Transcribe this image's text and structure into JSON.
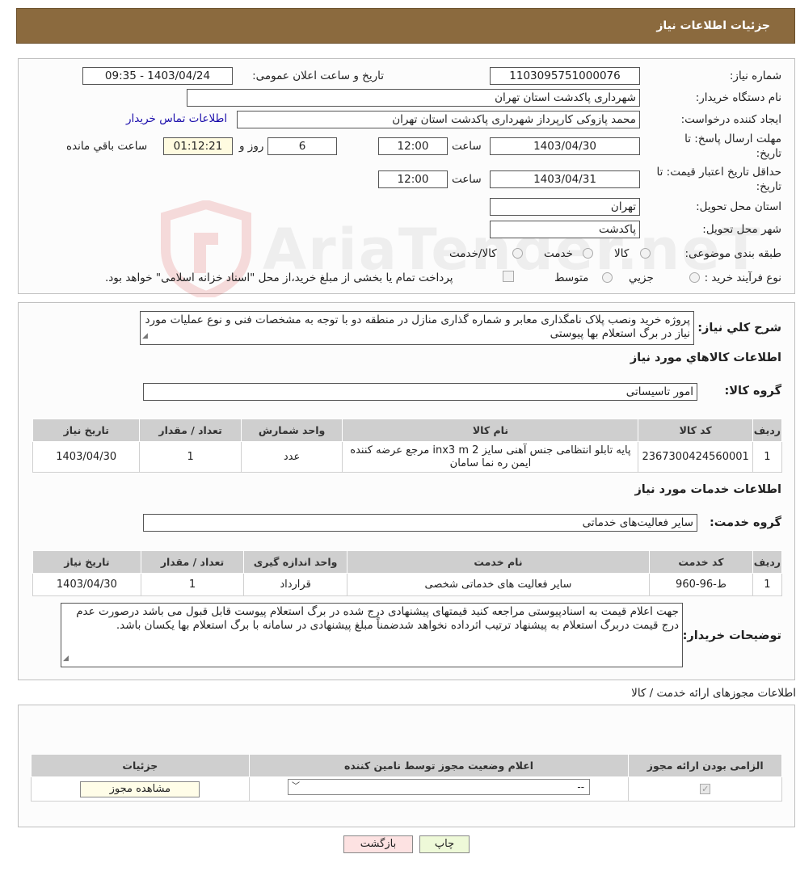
{
  "header": {
    "title": "جزئیات اطلاعات نیاز"
  },
  "need": {
    "number_label": "شماره نیاز:",
    "number_value": "1103095751000076",
    "announce_label": "تاریخ و ساعت اعلان عمومی:",
    "announce_value": "1403/04/24 - 09:35",
    "buyer_label": "نام دستگاه خریدار:",
    "buyer_value": "شهرداری پاکدشت استان تهران",
    "creator_label": "ایجاد کننده درخواست:",
    "creator_value": "محمد پازوکی کارپرداز شهرداری پاکدشت استان تهران",
    "contact_link": "اطلاعات تماس خریدار",
    "deadline_label_1": "مهلت ارسال پاسخ: تا",
    "deadline_label_2": "تاریخ:",
    "deadline_date": "1403/04/30",
    "time_label": "ساعت",
    "deadline_time": "12:00",
    "days_value": "6",
    "days_label": "روز و",
    "remaining_value": "01:12:21",
    "remaining_label": "ساعت باقي مانده",
    "validity_label_1": "حداقل تاریخ اعتبار قیمت: تا",
    "validity_label_2": "تاریخ:",
    "validity_date": "1403/04/31",
    "validity_time": "12:00",
    "province_label": "استان محل تحویل:",
    "province_value": "تهران",
    "city_label": "شهر محل تحویل:",
    "city_value": "پاکدشت",
    "category_label": "طبقه بندی موضوعی:",
    "category_options": [
      "کالا",
      "خدمت",
      "کالا/خدمت"
    ],
    "process_label": "نوع فرآیند خرید :",
    "process_options": [
      "جزیي",
      "متوسط"
    ],
    "process_note": "پرداخت تمام یا بخشی از مبلغ خرید،از محل \"اسناد خزانه اسلامی\" خواهد بود."
  },
  "watermark": {
    "text": "AriaTender.neT"
  },
  "description": {
    "label": "شرح کلي نياز:",
    "text": "پروژه خرید ونصب پلاک نامگذاری معابر و شماره گذاری منازل در منطقه دو با توجه به مشخصات فنی و نوع عملیات مورد نیاز در برگ استعلام بها پیوستی"
  },
  "goods": {
    "section_title": "اطلاعات کالاهاي مورد نياز",
    "group_label": "گروه کالا:",
    "group_value": "امور تاسیساتی",
    "headers": [
      "رديف",
      "کد کالا",
      "نام کالا",
      "واحد شمارش",
      "تعداد / مقدار",
      "تاريخ نياز"
    ],
    "rows": [
      [
        "1",
        "2367300424560001",
        "پایه تابلو انتظامی جنس آهنی سایز inx3 m 2 مرجع عرضه کننده ایمن ره نما سامان",
        "عدد",
        "1",
        "1403/04/30"
      ]
    ]
  },
  "services": {
    "section_title": "اطلاعات خدمات مورد نياز",
    "group_label": "گروه خدمت:",
    "group_value": "سایر فعالیت‌های خدماتی",
    "headers": [
      "رديف",
      "کد خدمت",
      "نام خدمت",
      "واحد اندازه گيری",
      "تعداد / مقدار",
      "تاريخ نياز"
    ],
    "rows": [
      [
        "1",
        "ط-96-960",
        "سایر فعالیت های خدماتی شخصی",
        "قرارداد",
        "1",
        "1403/04/30"
      ]
    ]
  },
  "buyer_notes": {
    "label": "توضيحات خريدار:",
    "text": "جهت اعلام قیمت به اسنادپیوستی مراجعه کنید قیمتهای پیشنهادی درج شده در برگ استعلام پیوست قابل قبول می باشد درصورت عدم درج قیمت دربرگ استعلام به پیشنهاد ترتیب اثرداده نخواهد شدضمناً مبلغ پیشنهادی در سامانه با برگ استعلام بها یکسان باشد."
  },
  "permits": {
    "section_title": "اطلاعات مجوزهای ارائه خدمت / کالا",
    "headers": [
      "الزامی بودن ارائه مجوز",
      "اعلام وضعیت مجوز توسط نامین کننده",
      "جزئیات"
    ],
    "select_value": "--",
    "view_button": "مشاهده مجوز"
  },
  "buttons": {
    "print": "چاپ",
    "back": "بازگشت"
  },
  "colors": {
    "header_bg": "#8b6a3e",
    "print_bg": "#eef9d8",
    "back_bg": "#fde2e2"
  }
}
